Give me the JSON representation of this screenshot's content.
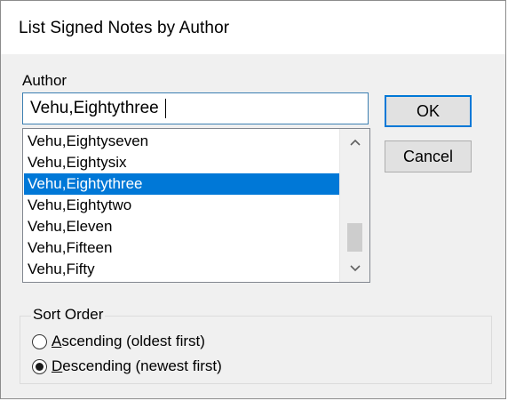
{
  "window": {
    "title": "List Signed Notes by Author"
  },
  "author": {
    "label": "Author",
    "value": "Vehu,Eightythree"
  },
  "list": {
    "items": [
      "Vehu,Eightyseven",
      "Vehu,Eightysix",
      "Vehu,Eightythree",
      "Vehu,Eightytwo",
      "Vehu,Eleven",
      "Vehu,Fifteen",
      "Vehu,Fifty"
    ],
    "selected_index": 2
  },
  "buttons": {
    "ok_label": "OK",
    "cancel_label": "Cancel"
  },
  "sort_order": {
    "label": "Sort Order",
    "ascending_first": "A",
    "ascending_rest": "scending (oldest first)",
    "descending_first": "D",
    "descending_rest": "escending (newest first)",
    "selected": "descending"
  },
  "icons": {
    "scroll_up": "chevron-up-icon",
    "scroll_down": "chevron-down-icon"
  }
}
